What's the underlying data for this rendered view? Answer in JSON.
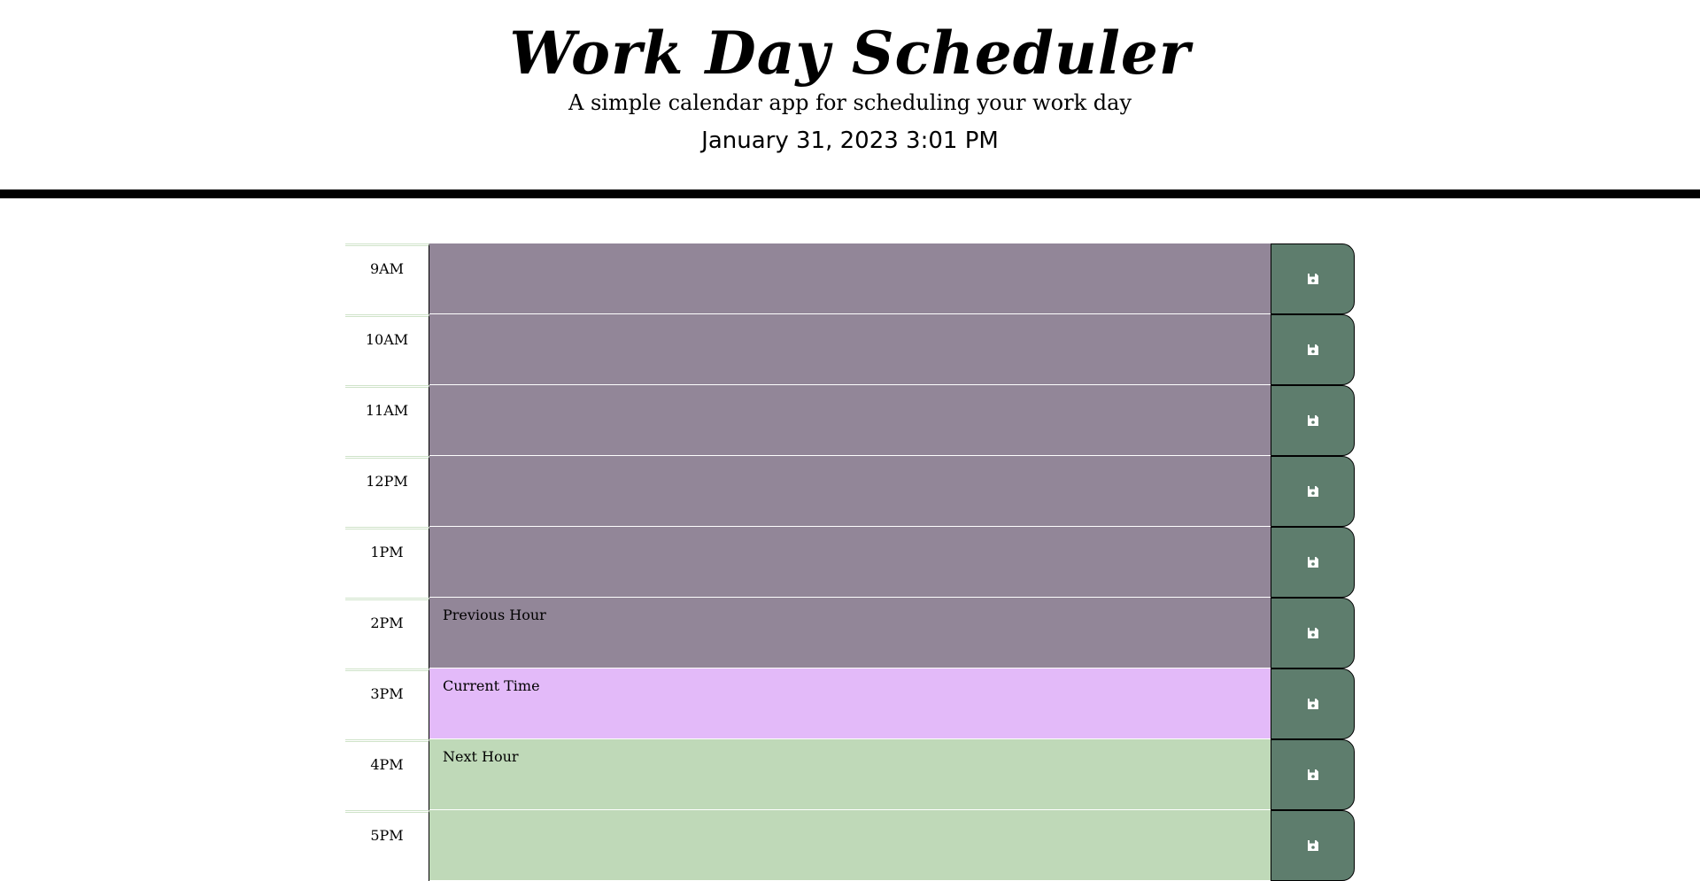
{
  "header": {
    "title": "Work Day Scheduler",
    "subtitle": "A simple calendar app for scheduling your work day",
    "current_datetime": "January 31, 2023 3:01 PM"
  },
  "time_blocks": [
    {
      "hour": "9AM",
      "text": "",
      "state": "past",
      "save_icon": "save-icon"
    },
    {
      "hour": "10AM",
      "text": "",
      "state": "past",
      "save_icon": "save-icon"
    },
    {
      "hour": "11AM",
      "text": "",
      "state": "past",
      "save_icon": "save-icon"
    },
    {
      "hour": "12PM",
      "text": "",
      "state": "past",
      "save_icon": "save-icon"
    },
    {
      "hour": "1PM",
      "text": "",
      "state": "past",
      "save_icon": "save-icon"
    },
    {
      "hour": "2PM",
      "text": "Previous Hour",
      "state": "past",
      "save_icon": "save-icon"
    },
    {
      "hour": "3PM",
      "text": "Current Time",
      "state": "present",
      "save_icon": "save-icon"
    },
    {
      "hour": "4PM",
      "text": "Next Hour",
      "state": "future",
      "save_icon": "save-icon"
    },
    {
      "hour": "5PM",
      "text": "",
      "state": "future",
      "save_icon": "save-icon"
    }
  ],
  "colors": {
    "past": "#928698",
    "present": "#e3baf9",
    "future": "#bfd9b8",
    "save_button": "#5e7d6d"
  }
}
